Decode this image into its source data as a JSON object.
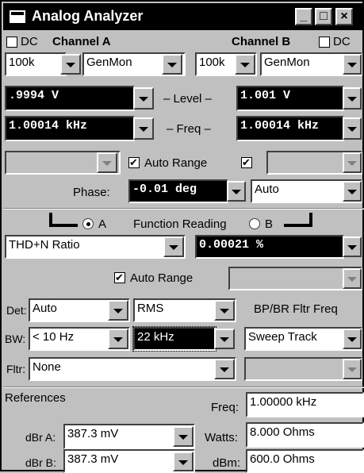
{
  "window": {
    "title": "Analog Analyzer",
    "minimize": "_",
    "maximize": "□",
    "close": "×"
  },
  "channels": {
    "dc_label": "DC",
    "a": {
      "label": "Channel A",
      "dc_checked": false,
      "range": "100k",
      "source": "GenMon",
      "level": ".9994  V",
      "freq": "1.00014 kHz",
      "auto_range_checked": true,
      "auto_range_label": "Auto Range"
    },
    "b": {
      "label": "Channel B",
      "dc_checked": false,
      "range": "100k",
      "source": "GenMon",
      "level": "1.001   V",
      "freq": "1.00014 kHz",
      "auto_range_checked": true
    },
    "level_label": "– Level –",
    "freq_label": "– Freq –"
  },
  "phase": {
    "label": "Phase:",
    "value": "-0.01  deg",
    "mode": "Auto"
  },
  "function": {
    "radio_a": "A",
    "radio_b": "B",
    "title": "Function Reading",
    "selected": "A",
    "type": "THD+N Ratio",
    "reading": "0.00021  %",
    "auto_range_label": "Auto Range",
    "auto_range_checked": true
  },
  "filters": {
    "det_label": "Det:",
    "det": "Auto",
    "det_mode": "RMS",
    "bw_label": "BW:",
    "bw_low": "< 10 Hz",
    "bw_high": "22 kHz",
    "fltr_label": "Fltr:",
    "fltr": "None",
    "bpbr_label": "BP/BR Fltr Freq",
    "bpbr": "Sweep Track"
  },
  "references": {
    "title": "References",
    "freq_label": "Freq:",
    "freq": "1.00000 kHz",
    "dbra_label": "dBr A:",
    "dbra": "387.3  mV",
    "watts_label": "Watts:",
    "watts": "8.000   Ohms",
    "dbrb_label": "dBr B:",
    "dbrb": "387.3  mV",
    "dbm_label": "dBm:",
    "dbm": "600.0   Ohms"
  },
  "icons": [
    "window-icon",
    "minimize-icon",
    "maximize-icon",
    "close-icon",
    "dropdown-arrow-icon",
    "checkbox-icon",
    "radio-icon"
  ]
}
